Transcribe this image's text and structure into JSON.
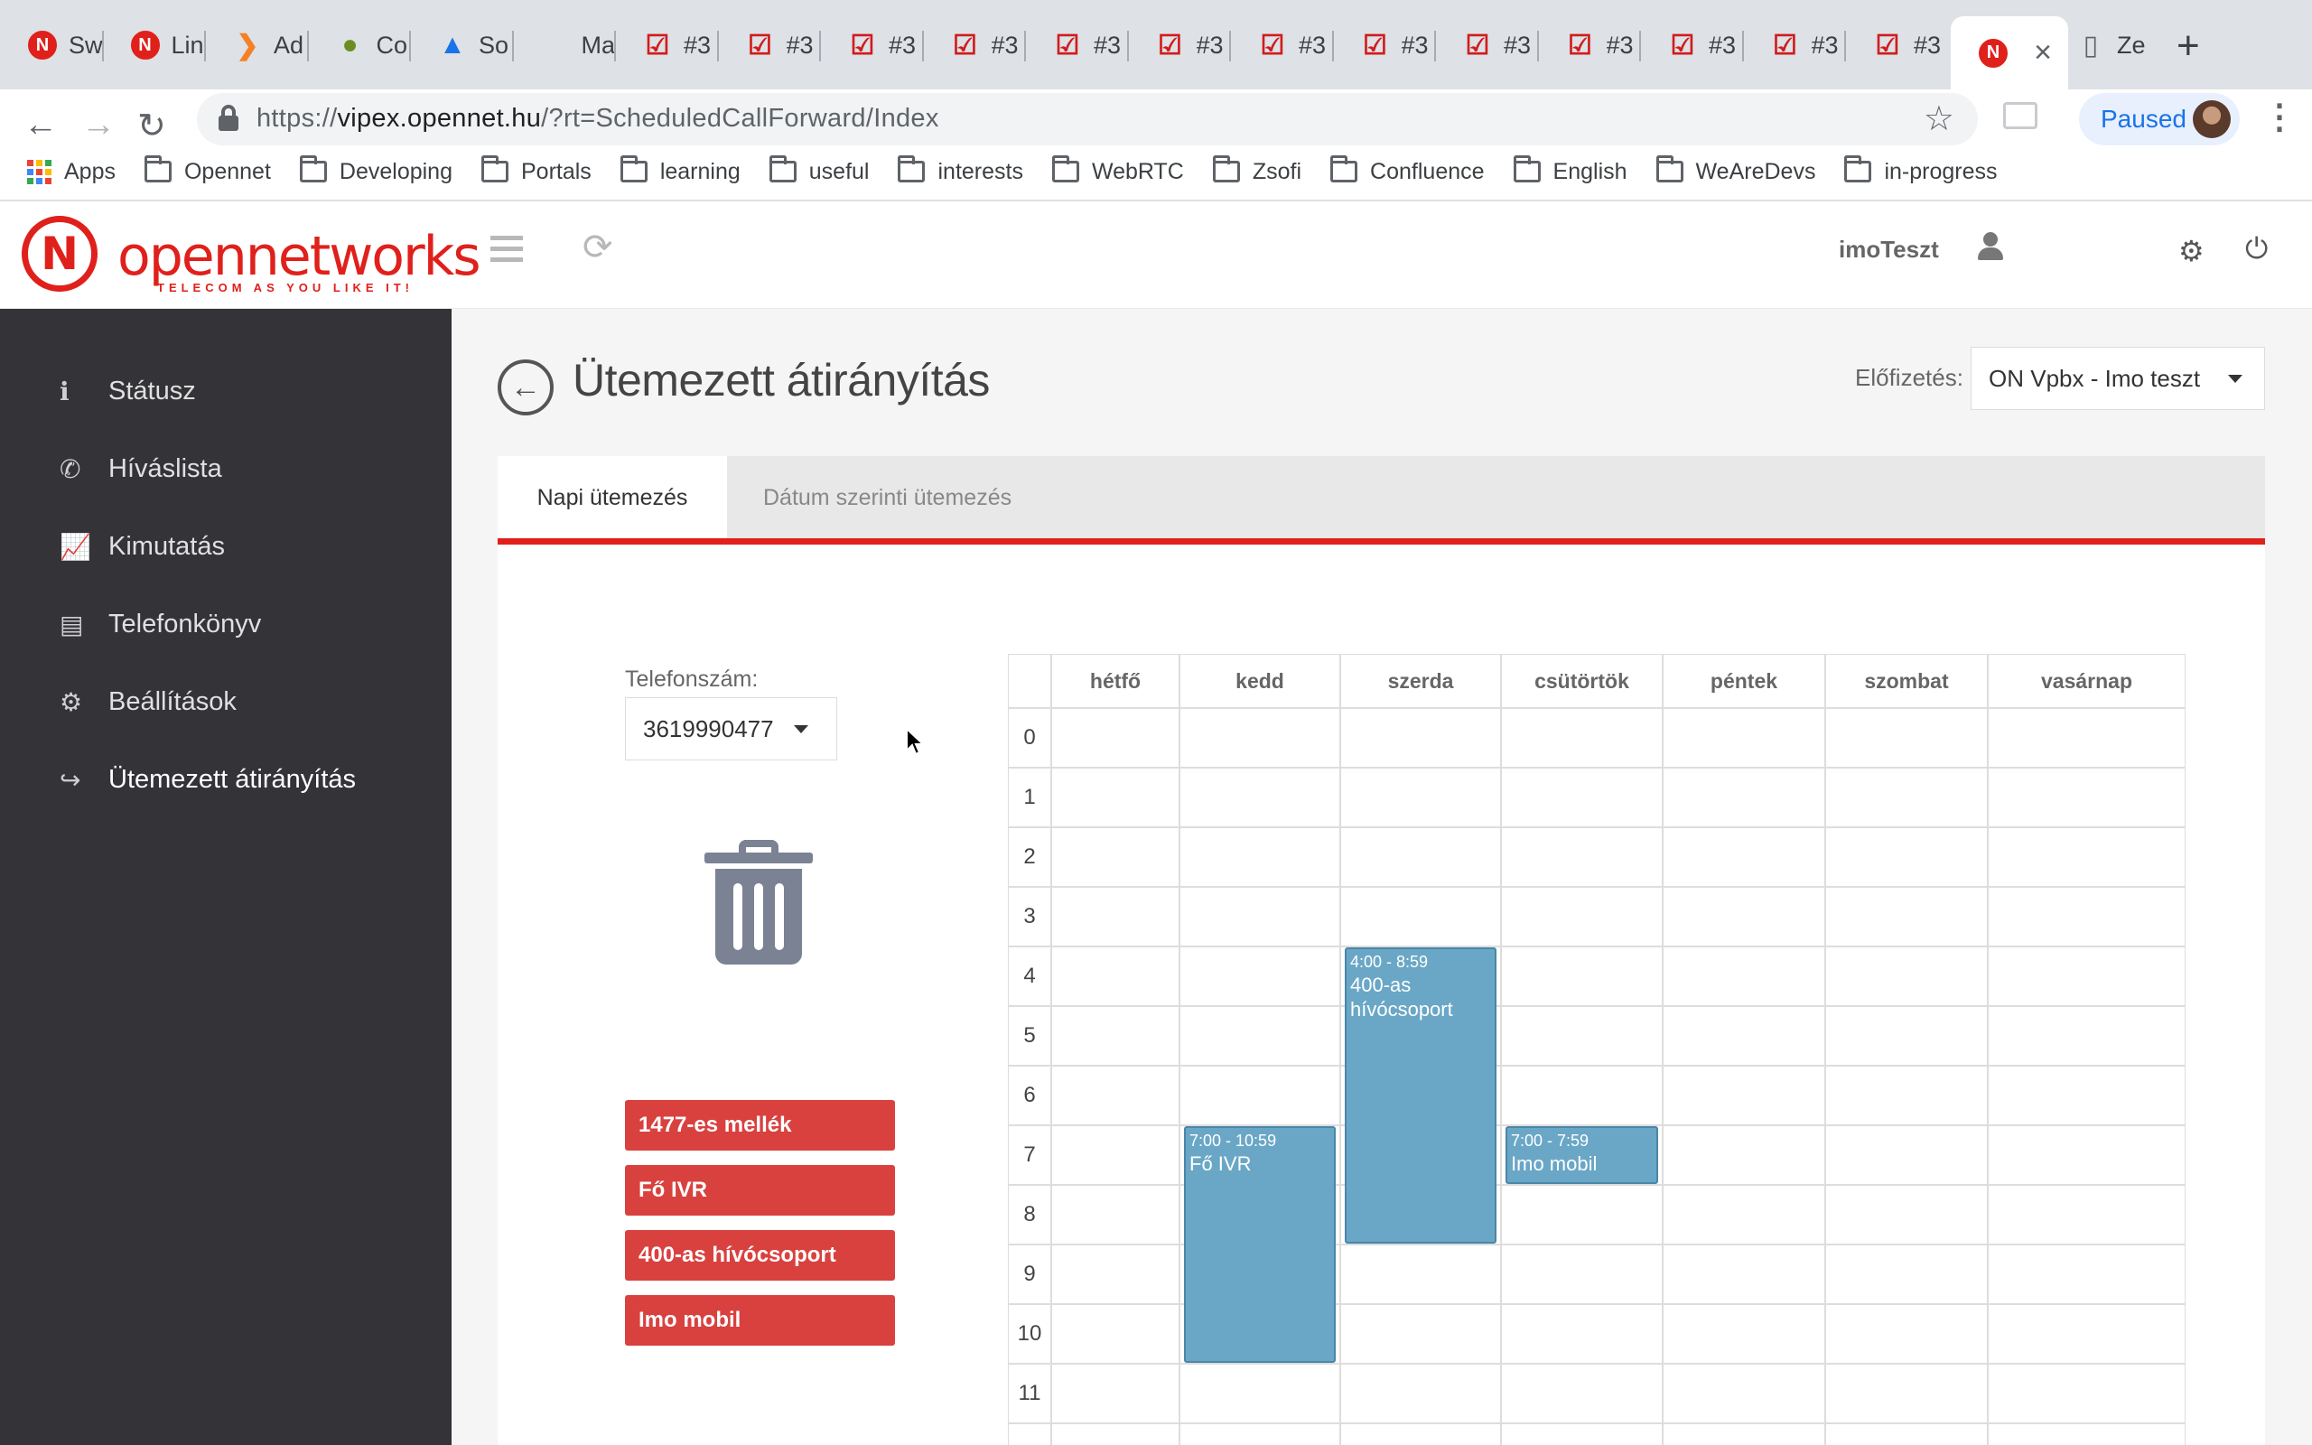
{
  "browser": {
    "tabs": [
      {
        "title": "Sw",
        "icon": "opennet-icon"
      },
      {
        "title": "Lin",
        "icon": "opennet-icon"
      },
      {
        "title": "Ad",
        "icon": "chevron-icon"
      },
      {
        "title": "Co",
        "icon": "android-icon"
      },
      {
        "title": "So",
        "icon": "triangle-icon"
      },
      {
        "title": "Ma",
        "icon": "apple-icon"
      },
      {
        "title": "#3",
        "icon": "checkbox-icon"
      },
      {
        "title": "#3",
        "icon": "checkbox-icon"
      },
      {
        "title": "#3",
        "icon": "checkbox-icon"
      },
      {
        "title": "#3",
        "icon": "checkbox-icon"
      },
      {
        "title": "#3",
        "icon": "checkbox-icon"
      },
      {
        "title": "#3",
        "icon": "checkbox-icon"
      },
      {
        "title": "#3",
        "icon": "checkbox-icon"
      },
      {
        "title": "#3",
        "icon": "checkbox-icon"
      },
      {
        "title": "#3",
        "icon": "checkbox-icon"
      },
      {
        "title": "#3",
        "icon": "checkbox-icon"
      },
      {
        "title": "#3",
        "icon": "checkbox-icon"
      },
      {
        "title": "#3",
        "icon": "checkbox-icon"
      },
      {
        "title": "#3",
        "icon": "checkbox-icon"
      },
      {
        "title": "",
        "icon": "opennet-icon",
        "active": true
      },
      {
        "title": "Ze",
        "icon": "page-icon"
      }
    ],
    "url_prefix": "https://",
    "url_host": "vipex.opennet.hu",
    "url_path": "/?rt=ScheduledCallForward/Index",
    "profile_status": "Paused",
    "bookmarks": [
      "Apps",
      "Opennet",
      "Developing",
      "Portals",
      "learning",
      "useful",
      "interests",
      "WebRTC",
      "Zsofi",
      "Confluence",
      "English",
      "WeAreDevs",
      "in-progress"
    ]
  },
  "header": {
    "logo_open": "open",
    "logo_networks": "networks",
    "logo_tagline": "TELECOM AS YOU LIKE IT!",
    "username": "imoTeszt"
  },
  "sidebar": {
    "items": [
      {
        "label": "Státusz",
        "icon": "info-icon"
      },
      {
        "label": "Híváslista",
        "icon": "phone-icon"
      },
      {
        "label": "Kimutatás",
        "icon": "chart-icon"
      },
      {
        "label": "Telefonkönyv",
        "icon": "book-icon"
      },
      {
        "label": "Beállítások",
        "icon": "cogs-icon"
      },
      {
        "label": "Ütemezett átirányítás",
        "icon": "share-icon",
        "active": true
      }
    ]
  },
  "page": {
    "title": "Ütemezett átirányítás",
    "subscription_label": "Előfizetés:",
    "subscription_value": "ON Vpbx - Imo teszt",
    "tabs": [
      "Napi ütemezés",
      "Dátum szerinti ütemezés"
    ],
    "phone_label": "Telefonszám:",
    "phone_value": "3619990477",
    "targets": [
      "1477-es mellék",
      "Fő IVR",
      "400-as hívócsoport",
      "Imo mobil"
    ]
  },
  "schedule": {
    "days": [
      "hétfő",
      "kedd",
      "szerda",
      "csütörtök",
      "péntek",
      "szombat",
      "vasárnap"
    ],
    "hours": [
      "0",
      "1",
      "2",
      "3",
      "4",
      "5",
      "6",
      "7",
      "8",
      "9",
      "10",
      "11"
    ],
    "events": [
      {
        "day": 1,
        "start": 7,
        "end": 10.99,
        "time": "7:00 - 10:59",
        "label": "Fő IVR"
      },
      {
        "day": 2,
        "start": 4,
        "end": 8.99,
        "time": "4:00 - 8:59",
        "label": "400-as hívócsoport"
      },
      {
        "day": 3,
        "start": 7,
        "end": 7.99,
        "time": "7:00 - 7:59",
        "label": "Imo mobil"
      }
    ]
  },
  "colors": {
    "brand_red": "#e0201b",
    "sidebar_bg": "#333338",
    "event_blue": "#6aa7c6",
    "target_red": "#d9413f"
  }
}
